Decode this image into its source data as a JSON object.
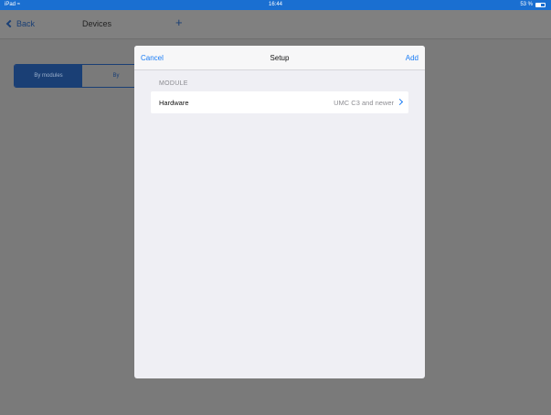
{
  "status_bar": {
    "carrier": "iPad",
    "wifi_icon": "wifi-icon",
    "time": "16:44",
    "battery_text": "53 %",
    "battery_level": 0.53
  },
  "background": {
    "back_label": "Back",
    "title": "Devices",
    "plus_label": "+",
    "segments": [
      {
        "label": "By modules",
        "selected": true
      },
      {
        "label": "By",
        "selected": false
      }
    ]
  },
  "modal": {
    "cancel_label": "Cancel",
    "title": "Setup",
    "add_label": "Add",
    "section_header": "MODULE",
    "row": {
      "label": "Hardware",
      "value": "UMC C3 and newer"
    }
  },
  "colors": {
    "accent": "#1a7cf5",
    "status_bar": "#1a6fd1",
    "dim_overlay": "#7a7a7a"
  }
}
